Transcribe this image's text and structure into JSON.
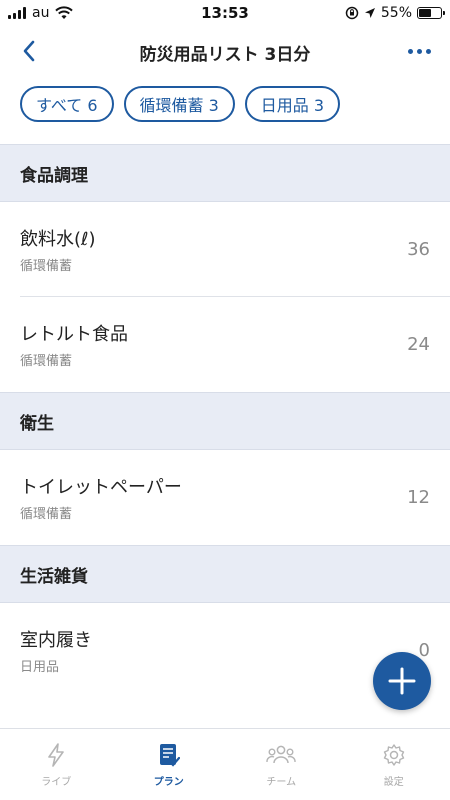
{
  "status": {
    "carrier": "au",
    "time": "13:53",
    "battery": "55%",
    "battery_level": 0.55
  },
  "header": {
    "title": "防災用品リスト 3日分"
  },
  "filters": [
    {
      "label": "すべて 6"
    },
    {
      "label": "循環備蓄 3"
    },
    {
      "label": "日用品 3"
    }
  ],
  "sections": [
    {
      "title": "食品調理",
      "items": [
        {
          "name": "飲料水(ℓ)",
          "tag": "循環備蓄",
          "count": "36"
        },
        {
          "name": "レトルト食品",
          "tag": "循環備蓄",
          "count": "24"
        }
      ]
    },
    {
      "title": "衛生",
      "items": [
        {
          "name": "トイレットペーパー",
          "tag": "循環備蓄",
          "count": "12"
        }
      ]
    },
    {
      "title": "生活雑貨",
      "items": [
        {
          "name": "室内履き",
          "tag": "日用品",
          "count": "0"
        }
      ]
    }
  ],
  "tabs": [
    {
      "label": "ライブ",
      "icon": "lightning-icon"
    },
    {
      "label": "プラン",
      "icon": "plan-list-icon"
    },
    {
      "label": "チーム",
      "icon": "team-icon"
    },
    {
      "label": "設定",
      "icon": "gear-icon"
    }
  ],
  "colors": {
    "accent": "#1e5aa0",
    "section_bg": "#e8ecf5",
    "muted": "#8a8a8a"
  }
}
